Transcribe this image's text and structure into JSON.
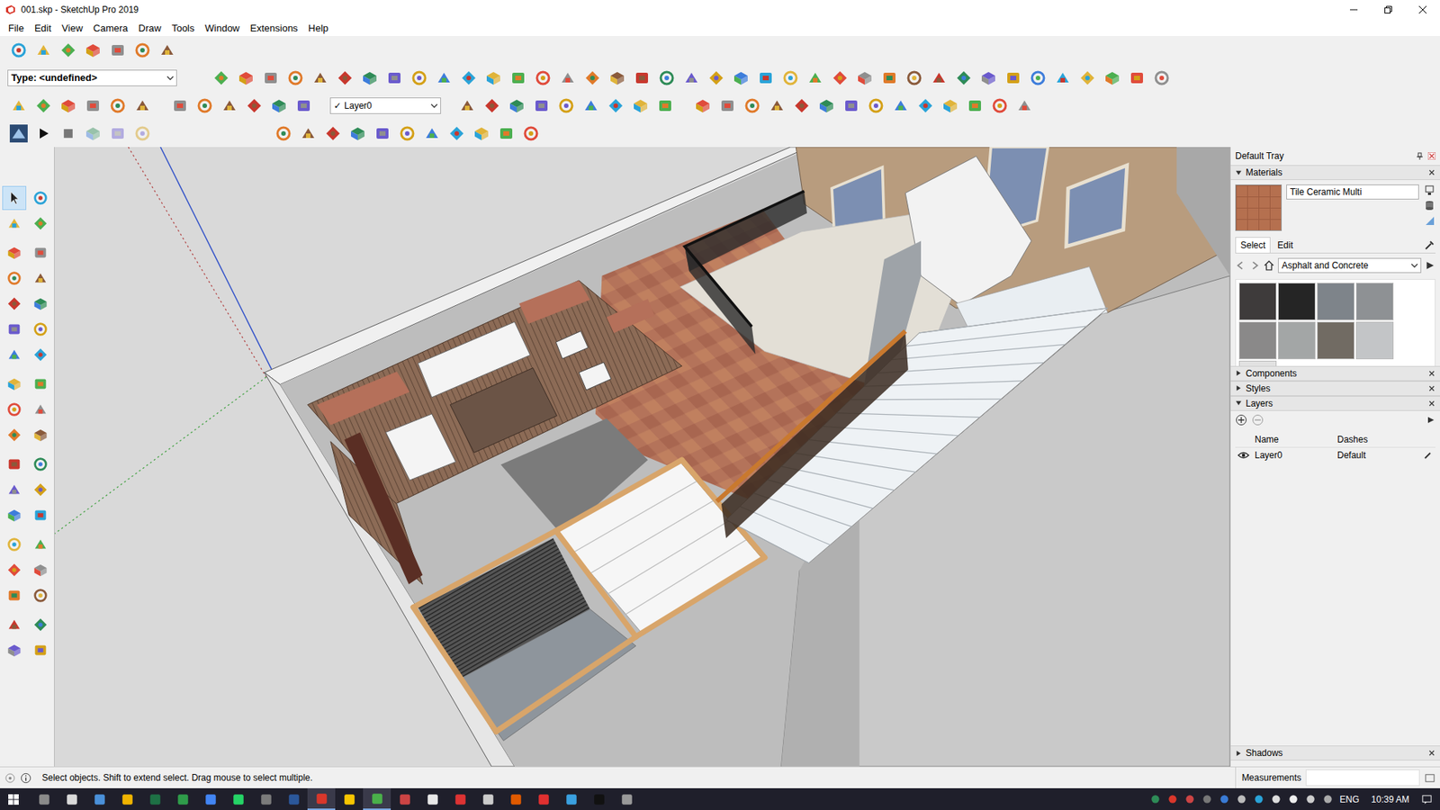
{
  "window": {
    "title": "001.skp - SketchUp Pro 2019"
  },
  "menu": [
    "File",
    "Edit",
    "View",
    "Camera",
    "Draw",
    "Tools",
    "Window",
    "Extensions",
    "Help"
  ],
  "toolbar": {
    "type_select": "Type: <undefined>",
    "layer_select": {
      "check": "✓",
      "value": "Layer0"
    }
  },
  "tool_palette": [
    {
      "selected": true
    },
    {
      "selected": false
    },
    {
      "selected": false
    },
    {
      "selected": false
    },
    {
      "selected": false
    },
    {
      "selected": false
    },
    {
      "selected": false
    },
    {
      "selected": false
    },
    {
      "selected": false
    },
    {
      "selected": false
    },
    {
      "selected": false
    },
    {
      "selected": false
    },
    {
      "selected": false
    },
    {
      "selected": false
    },
    {
      "selected": false
    },
    {
      "selected": false
    },
    {
      "selected": false
    },
    {
      "selected": false
    },
    {
      "selected": false
    },
    {
      "selected": false
    },
    {
      "selected": false
    },
    {
      "selected": false
    },
    {
      "selected": false
    },
    {
      "selected": false
    },
    {
      "selected": false
    },
    {
      "selected": false
    },
    {
      "selected": false
    },
    {
      "selected": false
    },
    {
      "selected": false
    },
    {
      "selected": false
    },
    {
      "selected": false
    },
    {
      "selected": false
    },
    {
      "selected": false
    },
    {
      "selected": false
    },
    {
      "selected": false
    },
    {
      "selected": false
    }
  ],
  "tray": {
    "title": "Default Tray",
    "materials": {
      "title": "Materials",
      "expanded": true,
      "current": {
        "name": "Tile Ceramic Multi",
        "color": "#b5704f"
      },
      "tabs": [
        {
          "label": "Select",
          "selected": true
        },
        {
          "label": "Edit",
          "selected": false
        }
      ],
      "library": "Asphalt and Concrete",
      "swatches": [
        {
          "color": "#3e3b3b"
        },
        {
          "color": "#252525"
        },
        {
          "color": "#7e848a"
        },
        {
          "color": "#8e9194"
        },
        {
          "color": "#8a8989"
        },
        {
          "color": "#a3a6a6"
        },
        {
          "color": "#716b63"
        },
        {
          "color": "#c3c5c7"
        },
        {
          "color": "#e1e1e1"
        }
      ]
    },
    "collapsed_panels": [
      {
        "title": "Components",
        "expanded": false
      },
      {
        "title": "Styles",
        "expanded": false
      }
    ],
    "layers": {
      "title": "Layers",
      "expanded": true,
      "columns": [
        "Name",
        "Dashes"
      ],
      "rows": [
        {
          "name": "Layer0",
          "dashes": "Default",
          "visible": true
        }
      ]
    },
    "bottom_panels": [
      {
        "title": "Shadows",
        "expanded": false
      }
    ]
  },
  "status_bar": {
    "message": "Select objects. Shift to extend select. Drag mouse to select multiple.",
    "measurements_label": "Measurements"
  },
  "taskbar": {
    "language": "ENG",
    "time": "10:39 AM"
  }
}
